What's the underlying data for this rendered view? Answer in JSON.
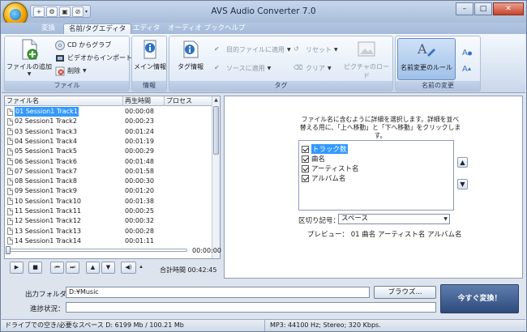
{
  "window": {
    "title": "AVS Audio Converter  7.0",
    "minimize": "–",
    "maximize": "□",
    "close": "✕"
  },
  "quick_access": [
    "+",
    "⚙",
    "▣",
    "⊘",
    "▾"
  ],
  "tabs": [
    "変換",
    "名前/タグエディタ",
    "エディタ",
    "オーディオ ブック",
    "ヘルプ"
  ],
  "active_tab_index": 1,
  "ribbon": {
    "file_group": {
      "caption": "ファイル",
      "add_files": "ファイルの追加",
      "cd_grab": "CD からグラブ",
      "video_import": "ビデオからインポート",
      "delete": "削除"
    },
    "info_group": {
      "caption": "情報",
      "menu_info": "メイン情報"
    },
    "tag_group": {
      "caption": "タグ",
      "tag_info": "タグ情報",
      "apply_target": "目的ファイルに適用",
      "apply_source": "ソースに適用",
      "reset": "リセット",
      "clear": "クリア",
      "load_picture": "ピクチャのロード"
    },
    "rename_group": {
      "caption": "名前の変更",
      "rules": "名前変更のルール"
    }
  },
  "file_list": {
    "columns": [
      "ファイル名",
      "再生時間",
      "プロセス"
    ],
    "rows": [
      {
        "name": "01 Session1 Track1",
        "duration": "00:00:08"
      },
      {
        "name": "02 Session1 Track2",
        "duration": "00:00:23"
      },
      {
        "name": "03 Session1 Track3",
        "duration": "00:01:24"
      },
      {
        "name": "04 Session1 Track4",
        "duration": "00:01:19"
      },
      {
        "name": "05 Session1 Track5",
        "duration": "00:00:29"
      },
      {
        "name": "06 Session1 Track6",
        "duration": "00:01:48"
      },
      {
        "name": "07 Session1 Track7",
        "duration": "00:01:58"
      },
      {
        "name": "08 Session1 Track8",
        "duration": "00:00:30"
      },
      {
        "name": "09 Session1 Track9",
        "duration": "00:01:20"
      },
      {
        "name": "10 Session1 Track10",
        "duration": "00:01:38"
      },
      {
        "name": "11 Session1 Track11",
        "duration": "00:00:25"
      },
      {
        "name": "12 Session1 Track12",
        "duration": "00:00:32"
      },
      {
        "name": "13 Session1 Track13",
        "duration": "00:00:28"
      },
      {
        "name": "14 Session1 Track14",
        "duration": "00:01:11"
      }
    ],
    "selected_index": 0
  },
  "player": {
    "position": "00:00:00",
    "total_label": "合計時間",
    "total_time": "00:42:45",
    "controls": [
      "▶",
      "■",
      "⏮",
      "⏭",
      "▲",
      "▼",
      "◀)",
      "▴"
    ]
  },
  "rename_panel": {
    "instruction": "ファイル名に含むように詳細を選択します。詳細を並べ替える用に、「上へ移動」と「下へ移動」をクリックします。",
    "options": [
      "トラック数",
      "曲名",
      "アーティスト名",
      "アルバム名"
    ],
    "move_up": "▲",
    "move_down": "▼",
    "separator_label": "区切り記号：",
    "separator_value": "スペース",
    "preview_label": "プレビュー：",
    "preview_value": "01 曲名 アーティスト名 アルバム名"
  },
  "output": {
    "folder_label": "出力フォルダ：",
    "folder_value": "D:¥Music",
    "browse": "ブラウズ...",
    "progress_label": "進捗状況：",
    "convert": "今すぐ変換！"
  },
  "status": {
    "disk": "ドライブでの空き/必要なスペース D: 6199 Mb / 100.21 Mb",
    "format": "MP3: 44100  Hz; Stereo; 320 Kbps."
  }
}
